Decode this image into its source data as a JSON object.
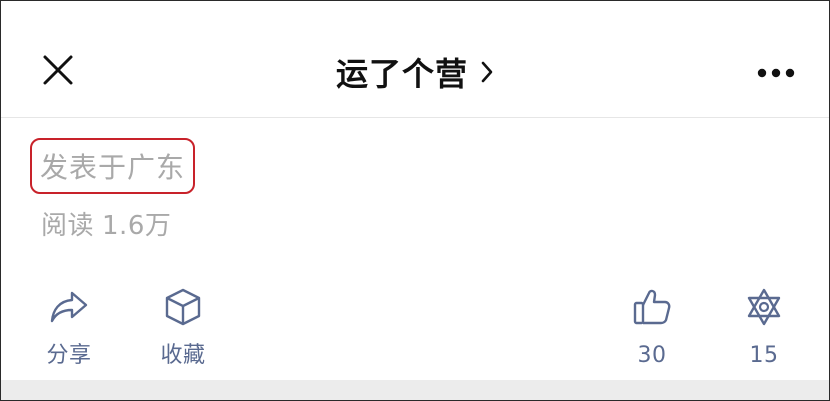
{
  "header": {
    "title": "运了个营",
    "title_chevron_icon": "chevron-right-icon",
    "close_icon": "close-icon",
    "more_icon": "more-horizontal-icon"
  },
  "meta": {
    "location": "发表于广东",
    "reads_label": "阅读",
    "reads_count": "1.6万"
  },
  "actions": {
    "share": {
      "label": "分享",
      "icon": "share-icon"
    },
    "collect": {
      "label": "收藏",
      "icon": "collect-icon"
    },
    "like": {
      "count": "30",
      "icon": "thumbs-up-icon"
    },
    "wow": {
      "count": "15",
      "icon": "wow-icon"
    }
  },
  "colors": {
    "accent_highlight": "#c8222a",
    "muted_text": "#a9a9a9",
    "action_blue": "#5a6a90",
    "title_text": "#111111"
  }
}
